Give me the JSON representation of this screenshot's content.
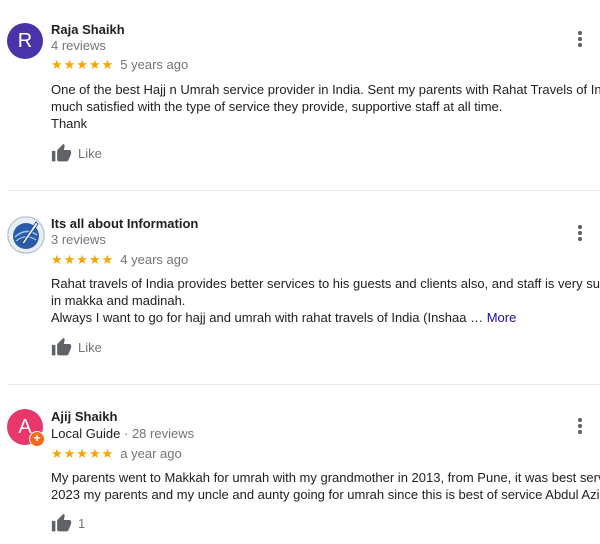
{
  "reviews": [
    {
      "avatar_letter": "R",
      "avatar_color": "#4a33a8",
      "name": "Raja Shaikh",
      "meta": "4 reviews",
      "stars": "★★★★★",
      "rating": 5,
      "time_ago": "5 years ago",
      "lines": [
        "One of the best Hajj n Umrah service provider in India. Sent my parents with Rahat Travels of India, very",
        "much satisfied with the type of service they provide, supportive staff at all time.",
        "Thank"
      ],
      "like_label": "Like"
    },
    {
      "avatar_icon": "quill-globe-icon",
      "name": "Its all about Information",
      "meta": "3 reviews",
      "stars": "★★★★★",
      "rating": 5,
      "time_ago": "4 years ago",
      "lines": [
        "Rahat travels of India provides better services to his guests and clients also, and staff is very supportive",
        "in makka and madinah.",
        "Always I want to go for hajj and umrah with rahat travels of India (Inshaa … "
      ],
      "more_label": "More",
      "like_label": "Like"
    },
    {
      "avatar_letter": "A",
      "avatar_color": "#e8386b",
      "badge_color": "#f26b1d",
      "name": "Ajij Shaikh",
      "guide_label": "Local Guide",
      "meta_suffix": " · 28 reviews",
      "stars": "★★★★★",
      "rating": 5,
      "time_ago": "a year ago",
      "lines": [
        "My parents went to Makkah for umrah with my grandmother in 2013, from Pune, it was best service,",
        "2023 my parents and my uncle and aunty going for umrah since  this is best of service Abdul Aziz"
      ],
      "like_count": "1"
    }
  ]
}
